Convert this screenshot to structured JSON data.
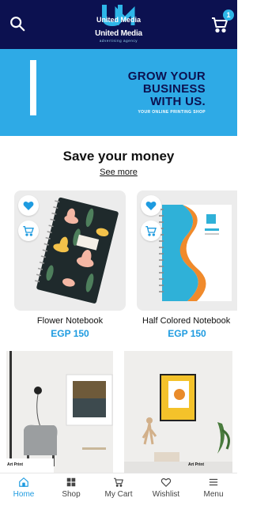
{
  "header": {
    "logo_mark": "UM",
    "logo_line1": "United Media",
    "logo_name": "United Media",
    "logo_tagline": "advertising agency",
    "cart_count": "1"
  },
  "banner": {
    "headline_line1": "GROW YOUR",
    "headline_line2": "BUSINESS",
    "headline_line3": "WITH US.",
    "tagline": "YOUR ONLINE PRINTING SHOP"
  },
  "section": {
    "title": "Save your money",
    "see_more": "See more"
  },
  "products": [
    {
      "name": "Flower Notebook",
      "price": "EGP 150"
    },
    {
      "name": "Half Colored Notebook",
      "price": "EGP 150"
    }
  ],
  "photos": [
    {
      "caption": "Art Print"
    },
    {
      "caption": "Art Print"
    }
  ],
  "nav": {
    "items": [
      {
        "label": "Home",
        "icon": "home-icon"
      },
      {
        "label": "Shop",
        "icon": "grid-icon"
      },
      {
        "label": "My Cart",
        "icon": "cart-icon"
      },
      {
        "label": "Wishlist",
        "icon": "heart-icon"
      },
      {
        "label": "Menu",
        "icon": "menu-icon"
      }
    ],
    "active": "Home"
  },
  "colors": {
    "header_bg": "#0c1150",
    "accent": "#1e9be0",
    "banner_bg": "#2eaae6"
  }
}
